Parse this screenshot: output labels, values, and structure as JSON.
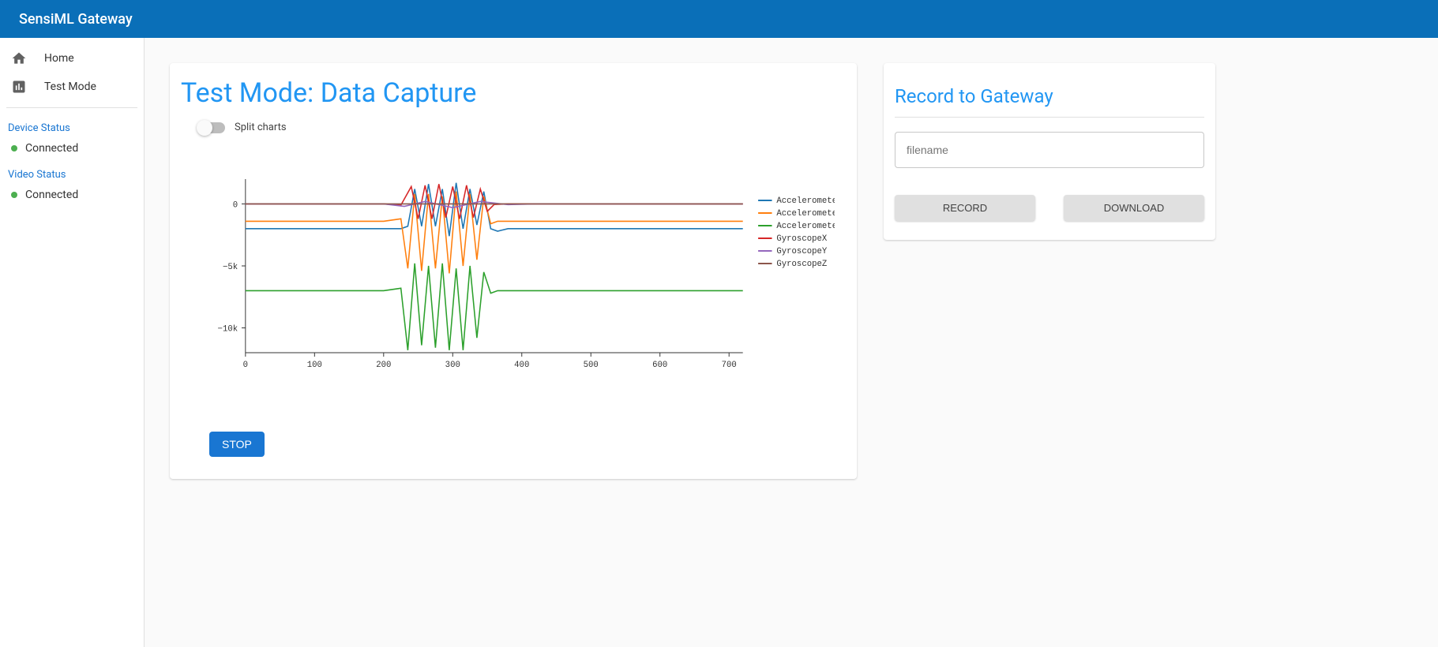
{
  "header": {
    "title": "SensiML Gateway"
  },
  "sidebar": {
    "nav": [
      {
        "label": "Home",
        "icon": "home"
      },
      {
        "label": "Test Mode",
        "icon": "bar-chart"
      }
    ],
    "statuses": [
      {
        "heading": "Device Status",
        "label": "Connected"
      },
      {
        "heading": "Video Status",
        "label": "Connected"
      }
    ]
  },
  "capture": {
    "title": "Test Mode: Data Capture",
    "split_label": "Split charts",
    "stop_label": "Stop"
  },
  "record": {
    "title": "Record to Gateway",
    "filename_placeholder": "filename",
    "record_label": "Record",
    "download_label": "Download"
  },
  "chart_data": {
    "type": "line",
    "xlabel": "",
    "ylabel": "",
    "xlim": [
      0,
      720
    ],
    "ylim": [
      -12000,
      2000
    ],
    "x_ticks": [
      0,
      100,
      200,
      300,
      400,
      500,
      600,
      700
    ],
    "y_ticks": [
      0,
      -5000,
      -10000
    ],
    "y_tick_labels": [
      "0",
      "−5k",
      "−10k"
    ],
    "series": [
      {
        "name": "AccelerometerX",
        "color": "#1f77b4",
        "x": [
          0,
          50,
          100,
          150,
          200,
          225,
          235,
          245,
          255,
          265,
          275,
          285,
          295,
          305,
          315,
          325,
          335,
          345,
          355,
          365,
          380,
          420,
          500,
          600,
          700,
          720
        ],
        "y": [
          -2000,
          -2000,
          -2000,
          -2000,
          -2000,
          -2000,
          -1800,
          1200,
          -1800,
          1600,
          -1800,
          1200,
          -2600,
          1700,
          -2000,
          1200,
          -1700,
          1000,
          -2000,
          -2200,
          -2000,
          -2000,
          -2000,
          -2000,
          -2000,
          -2000
        ]
      },
      {
        "name": "AccelerometerY",
        "color": "#ff7f0e",
        "x": [
          0,
          50,
          100,
          150,
          200,
          225,
          235,
          245,
          255,
          265,
          275,
          285,
          295,
          305,
          315,
          325,
          335,
          345,
          355,
          365,
          380,
          420,
          500,
          600,
          700,
          720
        ],
        "y": [
          -1400,
          -1400,
          -1400,
          -1400,
          -1400,
          -1200,
          -5200,
          800,
          -5400,
          800,
          -5200,
          600,
          -5600,
          1000,
          -5000,
          800,
          -4500,
          600,
          -1600,
          -1400,
          -1400,
          -1400,
          -1400,
          -1400,
          -1400,
          -1400
        ]
      },
      {
        "name": "AccelerometerZ",
        "color": "#2ca02c",
        "x": [
          0,
          50,
          100,
          150,
          200,
          225,
          235,
          245,
          255,
          265,
          275,
          285,
          295,
          305,
          315,
          325,
          335,
          345,
          355,
          365,
          380,
          420,
          500,
          600,
          700,
          720
        ],
        "y": [
          -7000,
          -7000,
          -7000,
          -7000,
          -7000,
          -6800,
          -11800,
          -4800,
          -11400,
          -5000,
          -11600,
          -4800,
          -11800,
          -5200,
          -11800,
          -5000,
          -10800,
          -5500,
          -7200,
          -7000,
          -7000,
          -7000,
          -7000,
          -7000,
          -7000,
          -7000
        ]
      },
      {
        "name": "GyroscopeX",
        "color": "#d62728",
        "x": [
          0,
          50,
          100,
          150,
          200,
          225,
          240,
          250,
          260,
          270,
          280,
          290,
          300,
          310,
          320,
          330,
          340,
          350,
          360,
          380,
          420,
          500,
          600,
          700,
          720
        ],
        "y": [
          0,
          0,
          0,
          0,
          0,
          -100,
          1400,
          -1200,
          1500,
          -1200,
          1600,
          -1100,
          1400,
          -1200,
          1500,
          -1100,
          1200,
          -600,
          -50,
          0,
          0,
          0,
          0,
          0,
          0
        ]
      },
      {
        "name": "GyroscopeY",
        "color": "#9467bd",
        "x": [
          0,
          50,
          100,
          150,
          200,
          230,
          260,
          300,
          340,
          380,
          420,
          500,
          600,
          700,
          720
        ],
        "y": [
          0,
          0,
          0,
          0,
          0,
          -200,
          200,
          -300,
          200,
          -60,
          0,
          0,
          0,
          0,
          0
        ]
      },
      {
        "name": "GyroscopeZ",
        "color": "#8c564b",
        "x": [
          0,
          100,
          200,
          300,
          400,
          500,
          600,
          700,
          720
        ],
        "y": [
          0,
          0,
          0,
          0,
          0,
          0,
          0,
          0,
          0
        ]
      }
    ]
  }
}
